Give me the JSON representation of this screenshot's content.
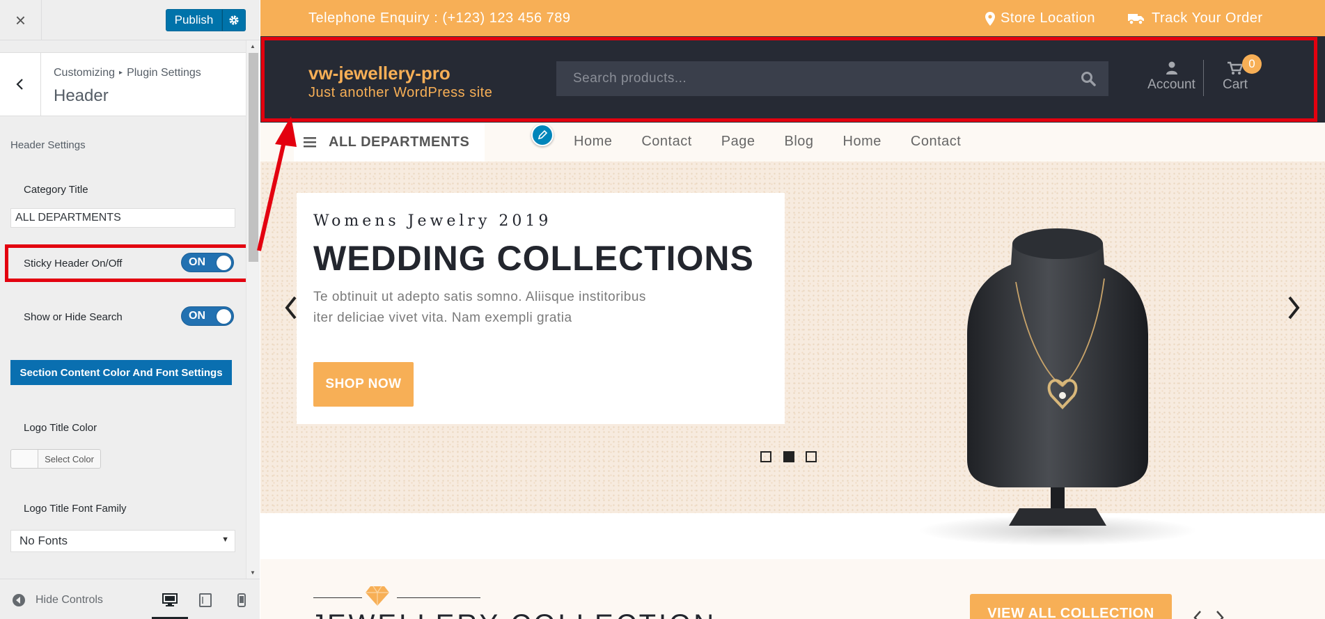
{
  "customizer": {
    "close_label": "×",
    "publish_label": "Publish",
    "breadcrumb": {
      "part1": "Customizing",
      "sep": "▸",
      "part2": "Plugin Settings"
    },
    "section_title": "Header",
    "group_heading": "Header Settings",
    "category_title": {
      "label": "Category Title",
      "value": "ALL DEPARTMENTS"
    },
    "sticky_header": {
      "label": "Sticky Header On/Off",
      "state": "ON"
    },
    "show_search": {
      "label": "Show or Hide Search",
      "state": "ON"
    },
    "section_button": "Section Content Color And Font Settings",
    "logo_title_color": {
      "label": "Logo Title Color",
      "button": "Select Color"
    },
    "logo_font_family": {
      "label": "Logo Title Font Family",
      "value": "No Fonts"
    },
    "footer": {
      "hide_controls": "Hide Controls"
    }
  },
  "preview": {
    "topbar": {
      "phone": "Telephone Enquiry : (+123) 123 456 789",
      "store_location": "Store Location",
      "track_order": "Track Your Order"
    },
    "header": {
      "site_title": "vw-jewellery-pro",
      "tagline": "Just another WordPress site",
      "search_placeholder": "Search products...",
      "account_label": "Account",
      "cart_label": "Cart",
      "cart_count": "0"
    },
    "nav": {
      "all_departments": "ALL DEPARTMENTS",
      "links": [
        "Home",
        "Contact",
        "Page",
        "Blog",
        "Home",
        "Contact"
      ]
    },
    "hero": {
      "kicker": "Womens Jewelry 2019",
      "title": "WEDDING COLLECTIONS",
      "text": "Te obtinuit ut adepto satis somno. Aliisque institoribus iter deliciae vivet vita. Nam exempli gratia",
      "button": "SHOP NOW",
      "slides": 3,
      "active_slide": 2
    },
    "collection": {
      "title": "JEWELLERY COLLECTION",
      "button": "VIEW ALL COLLECTION"
    }
  },
  "colors": {
    "accent": "#f7af56",
    "header_bg": "#262a34",
    "wp_blue": "#0073aa",
    "highlight_red": "#e3000f"
  }
}
